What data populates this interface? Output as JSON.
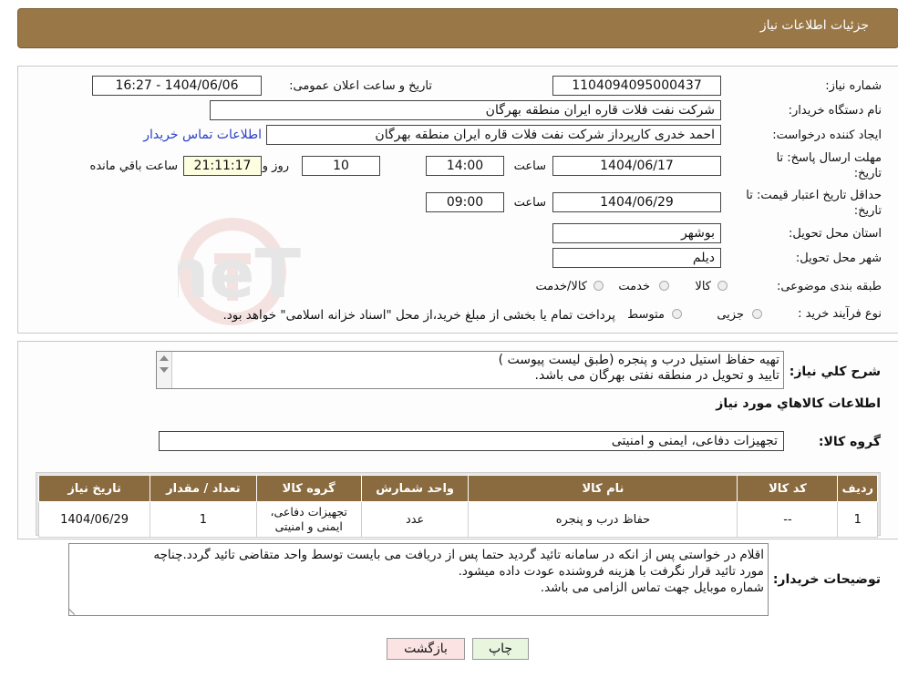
{
  "header": {
    "title": "جزئیات اطلاعات نیاز"
  },
  "info": {
    "need_number_label": "شماره نیاز:",
    "need_number": "1104094095000437",
    "announce_label": "تاریخ و ساعت اعلان عمومی:",
    "announce_value": "1404/06/06 - 16:27",
    "buyer_org_label": "نام دستگاه خریدار:",
    "buyer_org": "شرکت نفت فلات قاره ایران منطقه بهرگان",
    "creator_label": "ایجاد کننده درخواست:",
    "creator": "احمد خدری کارپرداز شرکت نفت فلات قاره ایران منطقه بهرگان",
    "contact_link": "اطلاعات تماس خریدار",
    "deadline_label_1": "مهلت ارسال پاسخ: تا",
    "deadline_label_2": "تاریخ:",
    "deadline_date": "1404/06/17",
    "time_label": "ساعت",
    "deadline_time": "14:00",
    "days_value": "10",
    "days_label": "روز و",
    "remaining_value": "21:11:17",
    "remaining_label": "ساعت باقي مانده",
    "validity_label_1": "حداقل تاریخ اعتبار قیمت: تا",
    "validity_label_2": "تاریخ:",
    "validity_date": "1404/06/29",
    "validity_time": "09:00",
    "province_label": "استان محل تحویل:",
    "province": "بوشهر",
    "city_label": "شهر محل تحویل:",
    "city": "دیلم",
    "category_label": "طبقه بندی موضوعی:",
    "category_options": [
      "کالا",
      "خدمت",
      "کالا/خدمت"
    ],
    "process_label": "نوع فرآیند خرید :",
    "process_options": [
      "جزیی",
      "متوسط"
    ],
    "process_note": "پرداخت تمام یا بخشی از مبلغ خرید،از محل \"اسناد خزانه اسلامی\" خواهد بود."
  },
  "description": {
    "label": "شرح کلي نياز:",
    "line1": "تهیه حفاظ استیل درب و پنجره (طبق لیست پیوست )",
    "line2": "تایید و تحویل در منطقه نفتی بهرگان می باشد."
  },
  "goods": {
    "section_title": "اطلاعات کالاهاي مورد نياز",
    "group_label": "گروه کالا:",
    "group_value": "تجهیزات دفاعی، ایمنی و امنیتی",
    "table_headers": [
      "ردیف",
      "کد کالا",
      "نام کالا",
      "واحد شمارش",
      "گروه کالا",
      "تعداد / مقدار",
      "تاریخ نیاز"
    ],
    "rows": [
      [
        "1",
        "--",
        "حفاظ درب و پنجره",
        "عدد",
        "تجهیزات دفاعی، ایمنی و امنیتی",
        "1",
        "1404/06/29"
      ]
    ]
  },
  "buyer_notes": {
    "label": "توضیحات خریدار:",
    "line1": "اقلام در خواستی پس از انکه در سامانه تائید گردید حتما پس از دریافت می بایست توسط واحد متقاضی تائید گردد.چناچه",
    "line2": "مورد تائید قرار نگرفت با هزینه فروشنده عودت داده میشود.",
    "line3": "شماره موبایل جهت تماس الزامی می باشد."
  },
  "buttons": {
    "print": "چاپ",
    "back": "بازگشت"
  },
  "watermark_text": "AriaTender.neT",
  "colors": {
    "header": "#9a7747",
    "table_header": "#8a6a3f",
    "back_button": "#fbe3e3",
    "print_button": "#e8f6df"
  }
}
